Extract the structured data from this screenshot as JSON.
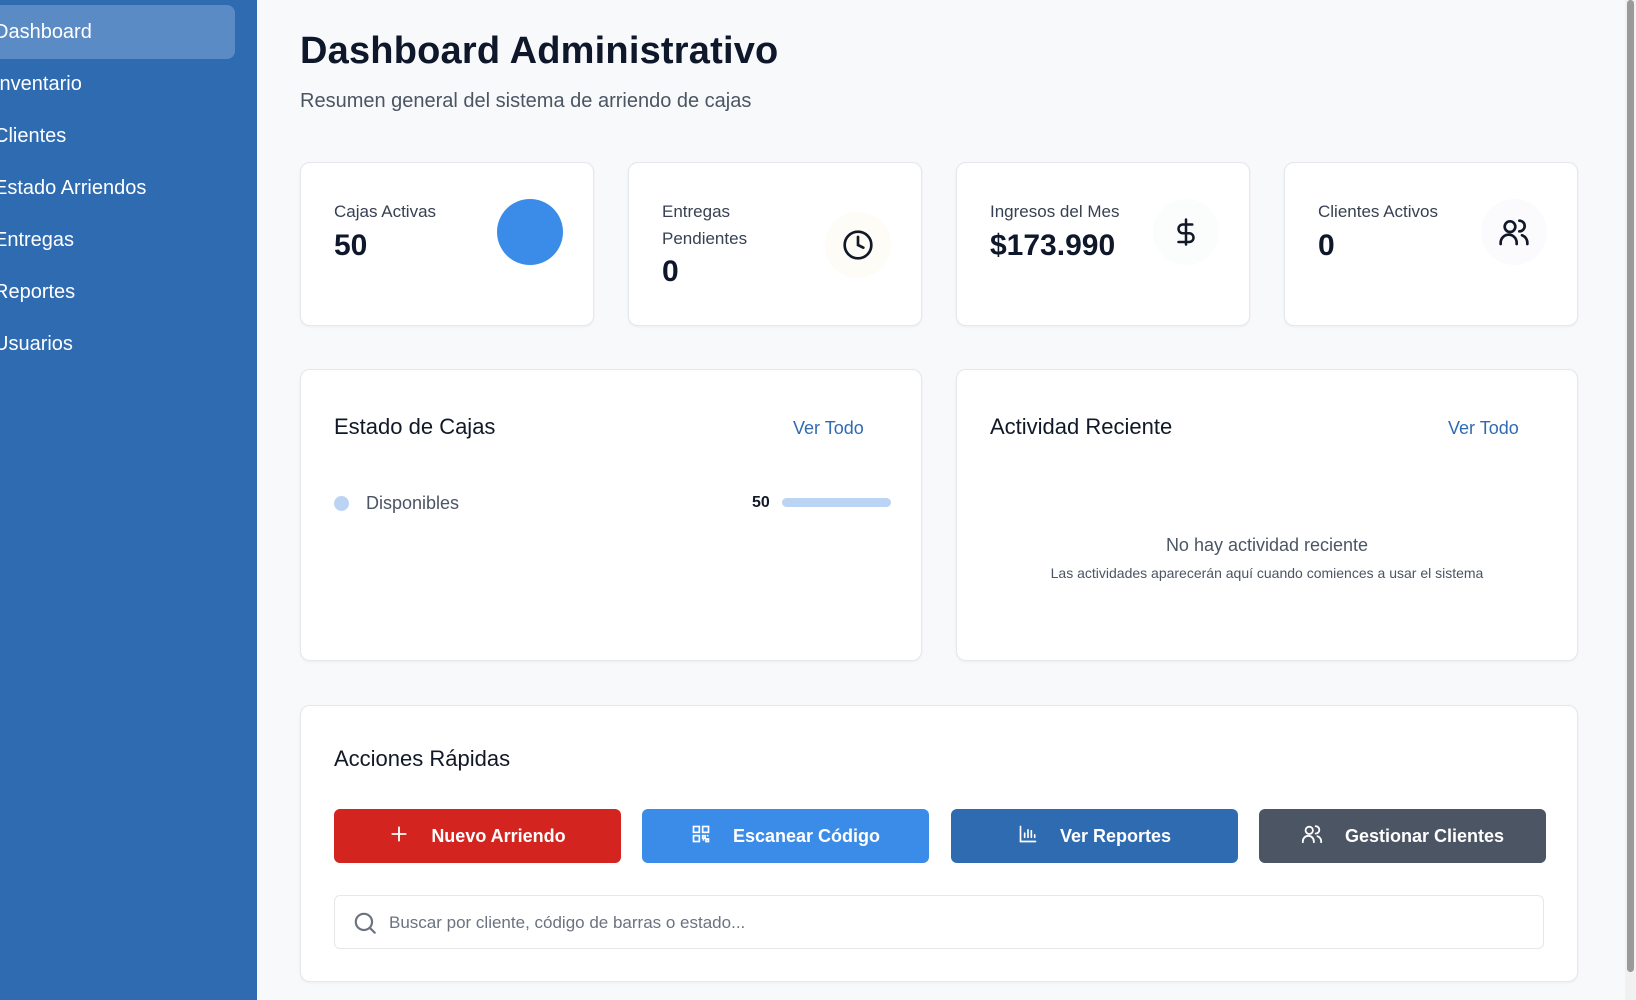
{
  "sidebar": {
    "items": [
      {
        "label": "Dashboard",
        "active": true
      },
      {
        "label": "Inventario"
      },
      {
        "label": "Clientes"
      },
      {
        "label": "Estado Arriendos"
      },
      {
        "label": "Entregas"
      },
      {
        "label": "Reportes"
      },
      {
        "label": "Usuarios"
      }
    ]
  },
  "header": {
    "title": "Dashboard Administrativo",
    "subtitle": "Resumen general del sistema de arriendo de cajas"
  },
  "stats": [
    {
      "label": "Cajas Activas",
      "value": "50",
      "icon": "circle-icon",
      "color": "#3b8ce8"
    },
    {
      "label": "Entregas Pendientes",
      "value": "0",
      "icon": "clock-icon"
    },
    {
      "label": "Ingresos del Mes",
      "value": "$173.990",
      "icon": "dollar-icon"
    },
    {
      "label": "Clientes Activos",
      "value": "0",
      "icon": "users-icon"
    }
  ],
  "estado_cajas": {
    "title": "Estado de Cajas",
    "link": "Ver Todo",
    "items": [
      {
        "label": "Disponibles",
        "count": "50",
        "fraction": 1.0,
        "color": "#bcd4f4"
      }
    ]
  },
  "actividad": {
    "title": "Actividad Reciente",
    "link": "Ver Todo",
    "empty_title": "No hay actividad reciente",
    "empty_sub": "Las actividades aparecerán aquí cuando comiences a usar el sistema"
  },
  "acciones": {
    "title": "Acciones Rápidas",
    "buttons": [
      {
        "label": "Nuevo Arriendo",
        "icon": "plus-icon",
        "color": "#d3241f"
      },
      {
        "label": "Escanear Código",
        "icon": "qr-code-icon",
        "color": "#3b8ce8"
      },
      {
        "label": "Ver Reportes",
        "icon": "bar-chart-icon",
        "color": "#2f6bb1"
      },
      {
        "label": "Gestionar Clientes",
        "icon": "users-icon",
        "color": "#4b5563"
      }
    ],
    "search_placeholder": "Buscar por cliente, código de barras o estado..."
  },
  "colors": {
    "sidebar": "#2f6bb1",
    "sidebar_active": "#5b8bc5",
    "accent": "#2f6bb1"
  }
}
